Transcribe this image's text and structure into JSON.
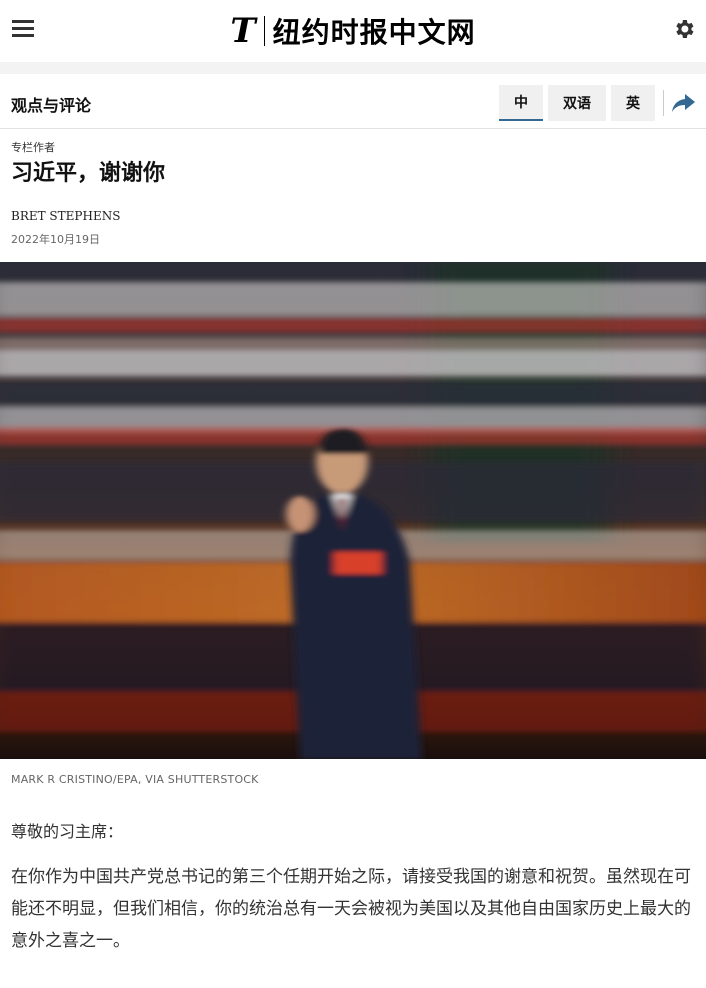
{
  "header": {
    "logo_mark": "T",
    "site_name": "纽约时报中文网"
  },
  "section": {
    "title": "观点与评论",
    "lang_tabs": [
      {
        "label": "中",
        "active": true
      },
      {
        "label": "双语",
        "active": false
      },
      {
        "label": "英",
        "active": false
      }
    ]
  },
  "article": {
    "kicker": "专栏作者",
    "headline": "习近平，谢谢你",
    "byline": "BRET STEPHENS",
    "date": "2022年10月19日",
    "photo_caption": "MARK R CRISTINO/EPA, VIA SHUTTERSTOCK",
    "salutation": "尊敬的习主席：",
    "paragraph": "在你作为中国共产党总书记的第三个任期开始之际，请接受我国的谢意和祝贺。虽然现在可能还不明显，但我们相信，你的统治总有一天会被视为美国以及其他自由国家历史上最大的意外之喜之一。"
  },
  "icons": {
    "menu": "hamburger-menu-icon",
    "settings": "gear-icon",
    "share": "share-arrow-icon"
  },
  "colors": {
    "accent": "#326891",
    "tab_bg": "#f0f0f0"
  }
}
